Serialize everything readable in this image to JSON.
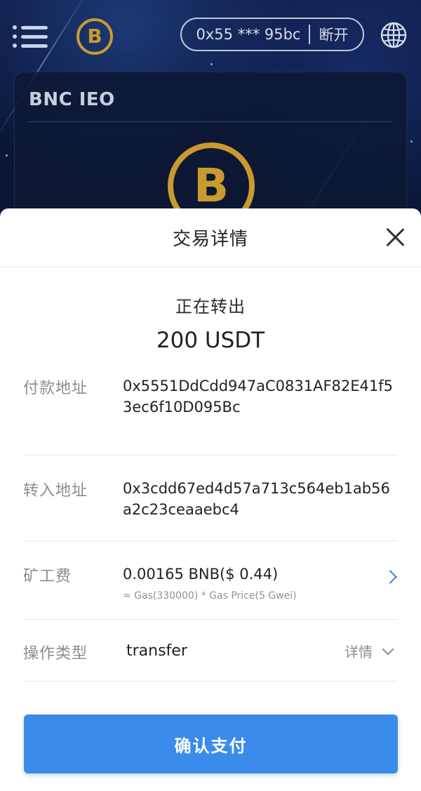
{
  "app": {
    "wallet_address_short": "0x55 *** 95bc",
    "disconnect_label": "断开",
    "card_title": "BNC IEO",
    "logo_letter": "B"
  },
  "sheet": {
    "title": "交易详情",
    "status": "正在转出",
    "amount": "200 USDT",
    "from_label": "付款地址",
    "from_address": "0x5551DdCdd947aC0831AF82E41f53ec6f10D095Bc",
    "to_label": "转入地址",
    "to_address": "0x3cdd67ed4d57a713c564eb1ab56a2c23ceaaebc4",
    "fee_label": "矿工费",
    "fee_value": "0.00165 BNB($ 0.44)",
    "fee_detail": "≈ Gas(330000) * Gas Price(5 Gwei)",
    "op_label": "操作类型",
    "op_value": "transfer",
    "details_label": "详情",
    "confirm_label": "确认支付"
  },
  "colors": {
    "accent": "#3b8bea",
    "brand_gold": "#c99a2e",
    "bg_dark": "#0b1530"
  },
  "icons": [
    "menu-icon",
    "brand-logo-icon",
    "globe-icon",
    "close-icon",
    "chevron-right-icon",
    "chevron-down-icon"
  ]
}
